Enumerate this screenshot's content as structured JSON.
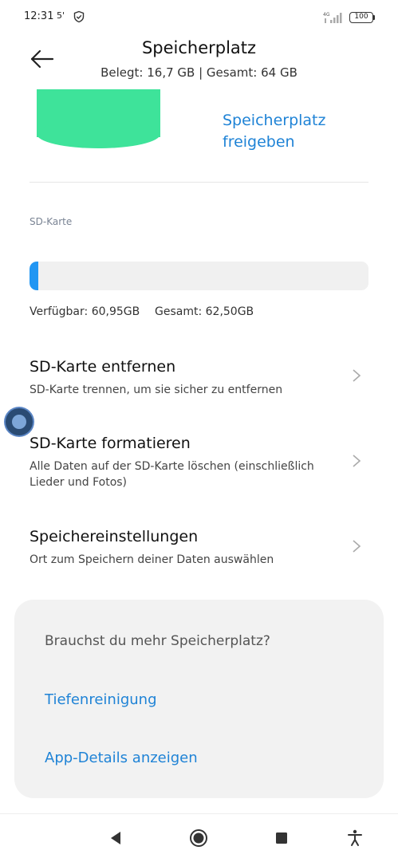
{
  "status_bar": {
    "time": "12:31",
    "extra": "5'",
    "network": "4G",
    "battery": "100"
  },
  "header": {
    "title": "Speicherplatz",
    "subtitle": "Belegt: 16,7 GB | Gesamt: 64 GB",
    "back_icon": "arrow-left-icon"
  },
  "storage_graphic": {
    "color": "#3ee39a"
  },
  "free_link": {
    "line1": "Speicherplatz",
    "line2": "freigeben"
  },
  "sd_section": {
    "label": "SD-Karte",
    "used_fraction": 0.025,
    "bar_color": "#2196f3",
    "available": "Verfügbar: 60,95GB",
    "total": "Gesamt: 62,50GB"
  },
  "items": [
    {
      "title": "SD-Karte entfernen",
      "subtitle": "SD-Karte trennen, um sie sicher zu entfernen"
    },
    {
      "title": "SD-Karte formatieren",
      "subtitle": "Alle Daten auf der SD-Karte löschen (einschließlich Lieder und Fotos)"
    },
    {
      "title": "Speichereinstellungen",
      "subtitle": "Ort zum Speichern deiner Daten auswählen"
    }
  ],
  "card": {
    "title": "Brauchst du mehr Speicherplatz?",
    "link1": "Tiefenreinigung",
    "link2": "App-Details anzeigen"
  },
  "navbar": {
    "back_icon": "triangle-back-icon",
    "home_icon": "circle-home-icon",
    "recents_icon": "square-recents-icon",
    "accessibility_icon": "accessibility-icon"
  }
}
